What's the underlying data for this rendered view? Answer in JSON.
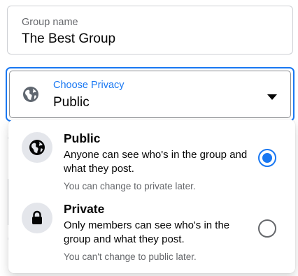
{
  "group_name": {
    "label": "Group name",
    "value": "The Best Group"
  },
  "privacy": {
    "label": "Choose Privacy",
    "value": "Public",
    "icon": "globe-icon",
    "caret_icon": "caret-down-icon"
  },
  "options": [
    {
      "title": "Public",
      "description": "Anyone can see who's in the group and what they post.",
      "note": "You can change to private later.",
      "icon": "globe-icon",
      "selected": true
    },
    {
      "title": "Private",
      "description": "Only members can see who's in the group and what they post.",
      "note": "You can't change to public later.",
      "icon": "lock-icon",
      "selected": false
    }
  ],
  "colors": {
    "accent": "#1877f2",
    "secondary_text": "#65676b",
    "icon_background": "#e4e6eb",
    "border": "#ced0d4"
  }
}
